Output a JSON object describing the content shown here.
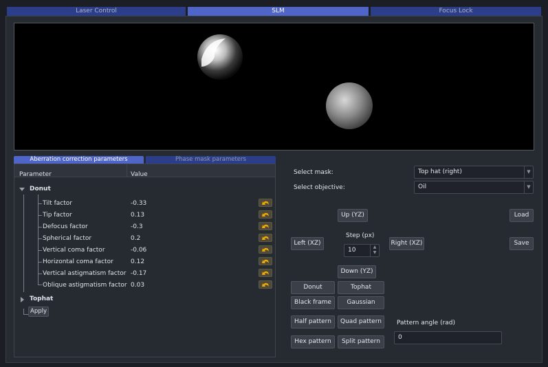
{
  "main_tabs": [
    "Laser Control",
    "SLM",
    "Focus Lock"
  ],
  "sub_tabs": [
    "Aberration correction parameters",
    "Phase mask parameters"
  ],
  "tree": {
    "headers": [
      "Parameter",
      "Value"
    ],
    "donut_label": "Donut",
    "rows": [
      {
        "label": "Tilt factor",
        "value": "-0.33"
      },
      {
        "label": "Tip factor",
        "value": "0.13"
      },
      {
        "label": "Defocus factor",
        "value": "-0.3"
      },
      {
        "label": "Spherical factor",
        "value": "0.2"
      },
      {
        "label": "Vertical coma factor",
        "value": "-0.06"
      },
      {
        "label": "Horizontal coma factor",
        "value": "0.12"
      },
      {
        "label": "Vertical astigmatism factor",
        "value": "-0.17"
      },
      {
        "label": "Oblique astigmatism factor",
        "value": "0.03"
      }
    ],
    "tophat_label": "Tophat",
    "apply_label": "Apply"
  },
  "controls": {
    "select_mask_label": "Select mask:",
    "select_mask_value": "Top hat (right)",
    "select_objective_label": "Select objective:",
    "select_objective_value": "Oil",
    "up": "Up (YZ)",
    "down": "Down (YZ)",
    "left": "Left (XZ)",
    "right": "Right (XZ)",
    "step_label": "Step (px)",
    "step_value": "10",
    "load": "Load",
    "save": "Save",
    "donut": "Donut",
    "tophat": "Tophat",
    "black_frame": "Black frame",
    "gaussian": "Gaussian",
    "half_pattern": "Half pattern",
    "quad_pattern": "Quad pattern",
    "hex_pattern": "Hex pattern",
    "split_pattern": "Split pattern",
    "pattern_angle_label": "Pattern angle (rad)",
    "pattern_angle_value": "0"
  },
  "colors": {
    "tab_active": "#4f66c8",
    "tab_inactive": "#2c3e8a",
    "background": "#1b1e24",
    "reset_icon": "#f2a900"
  },
  "icons": {
    "reset": "undo-arrow-icon",
    "expand": "triangle-down-icon",
    "collapse": "triangle-right-icon"
  }
}
